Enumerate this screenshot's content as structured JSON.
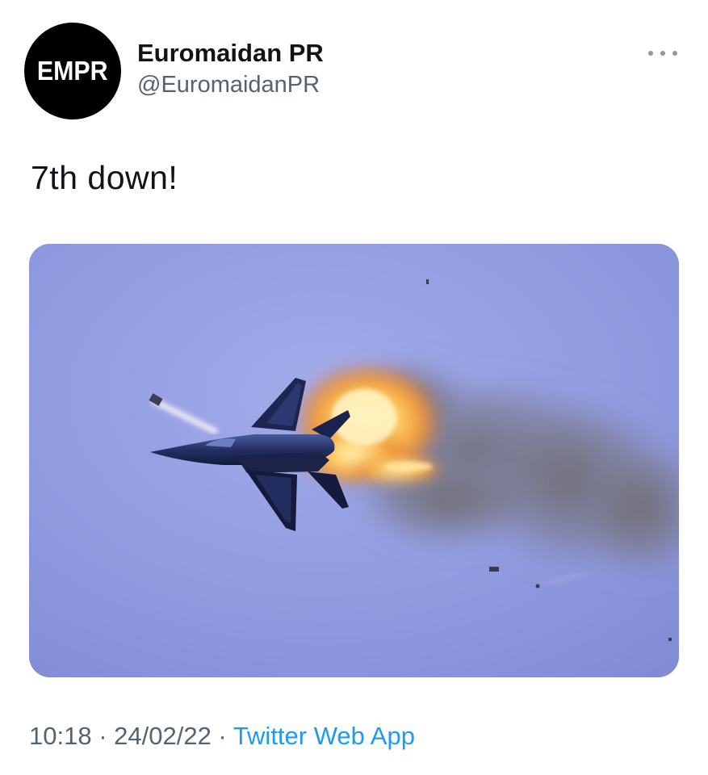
{
  "author": {
    "avatar_text": "EMPR",
    "display_name": "Euromaidan PR",
    "handle": "@EuromaidanPR"
  },
  "tweet": {
    "text": "7th down!"
  },
  "meta": {
    "time": "10:18",
    "separator": " · ",
    "date": "24/02/22",
    "source": "Twitter Web App"
  },
  "colors": {
    "text_primary": "#0f1419",
    "text_secondary": "#536471",
    "link": "#1d9bf0",
    "sky": "#8f9ade"
  },
  "icons": {
    "more": "more-options-icon"
  }
}
